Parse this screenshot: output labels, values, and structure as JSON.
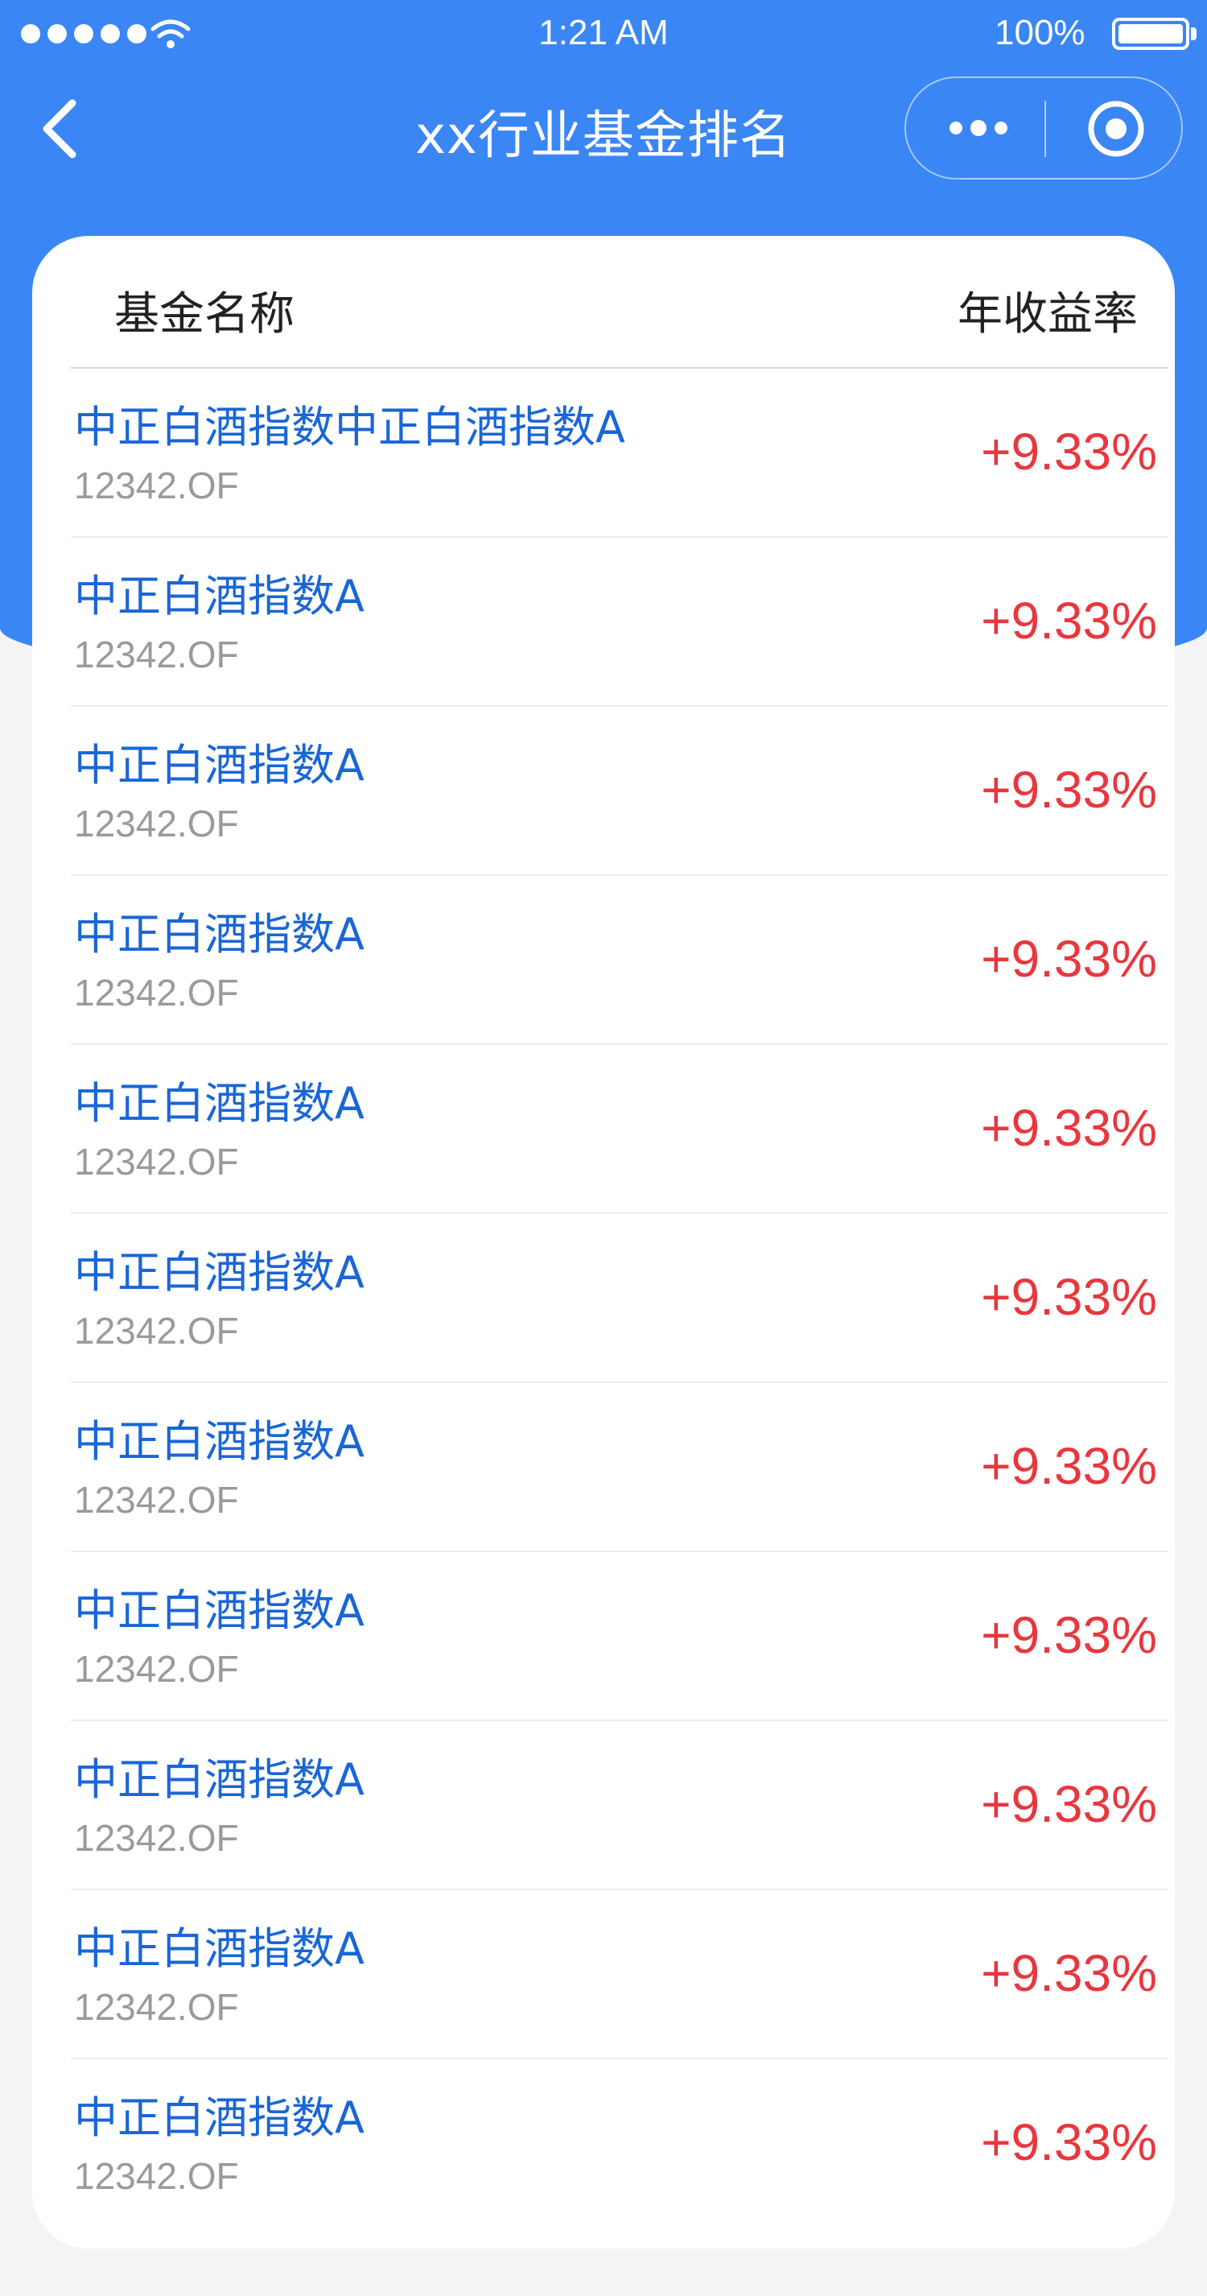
{
  "status_bar": {
    "time": "1:21 AM",
    "battery_percent": "100%",
    "icons": [
      "signal-dots-icon",
      "wifi-icon",
      "battery-icon"
    ]
  },
  "nav": {
    "title": "xx行业基金排名",
    "icons": [
      "back-arrow-icon",
      "more-dots-icon",
      "target-icon"
    ]
  },
  "table": {
    "header": {
      "name_col": "基金名称",
      "rate_col": "年收益率"
    },
    "rows": [
      {
        "name": "中正白酒指数中正白酒指数A",
        "code": "12342.OF",
        "rate": "+9.33%"
      },
      {
        "name": "中正白酒指数A",
        "code": "12342.OF",
        "rate": "+9.33%"
      },
      {
        "name": "中正白酒指数A",
        "code": "12342.OF",
        "rate": "+9.33%"
      },
      {
        "name": "中正白酒指数A",
        "code": "12342.OF",
        "rate": "+9.33%"
      },
      {
        "name": "中正白酒指数A",
        "code": "12342.OF",
        "rate": "+9.33%"
      },
      {
        "name": "中正白酒指数A",
        "code": "12342.OF",
        "rate": "+9.33%"
      },
      {
        "name": "中正白酒指数A",
        "code": "12342.OF",
        "rate": "+9.33%"
      },
      {
        "name": "中正白酒指数A",
        "code": "12342.OF",
        "rate": "+9.33%"
      },
      {
        "name": "中正白酒指数A",
        "code": "12342.OF",
        "rate": "+9.33%"
      },
      {
        "name": "中正白酒指数A",
        "code": "12342.OF",
        "rate": "+9.33%"
      },
      {
        "name": "中正白酒指数A",
        "code": "12342.OF",
        "rate": "+9.33%"
      }
    ]
  },
  "colors": {
    "primary_blue": "#3a86f4",
    "fund_name_blue": "#1a66d6",
    "rate_red": "#e8373e",
    "code_gray": "#9a9a9a"
  }
}
